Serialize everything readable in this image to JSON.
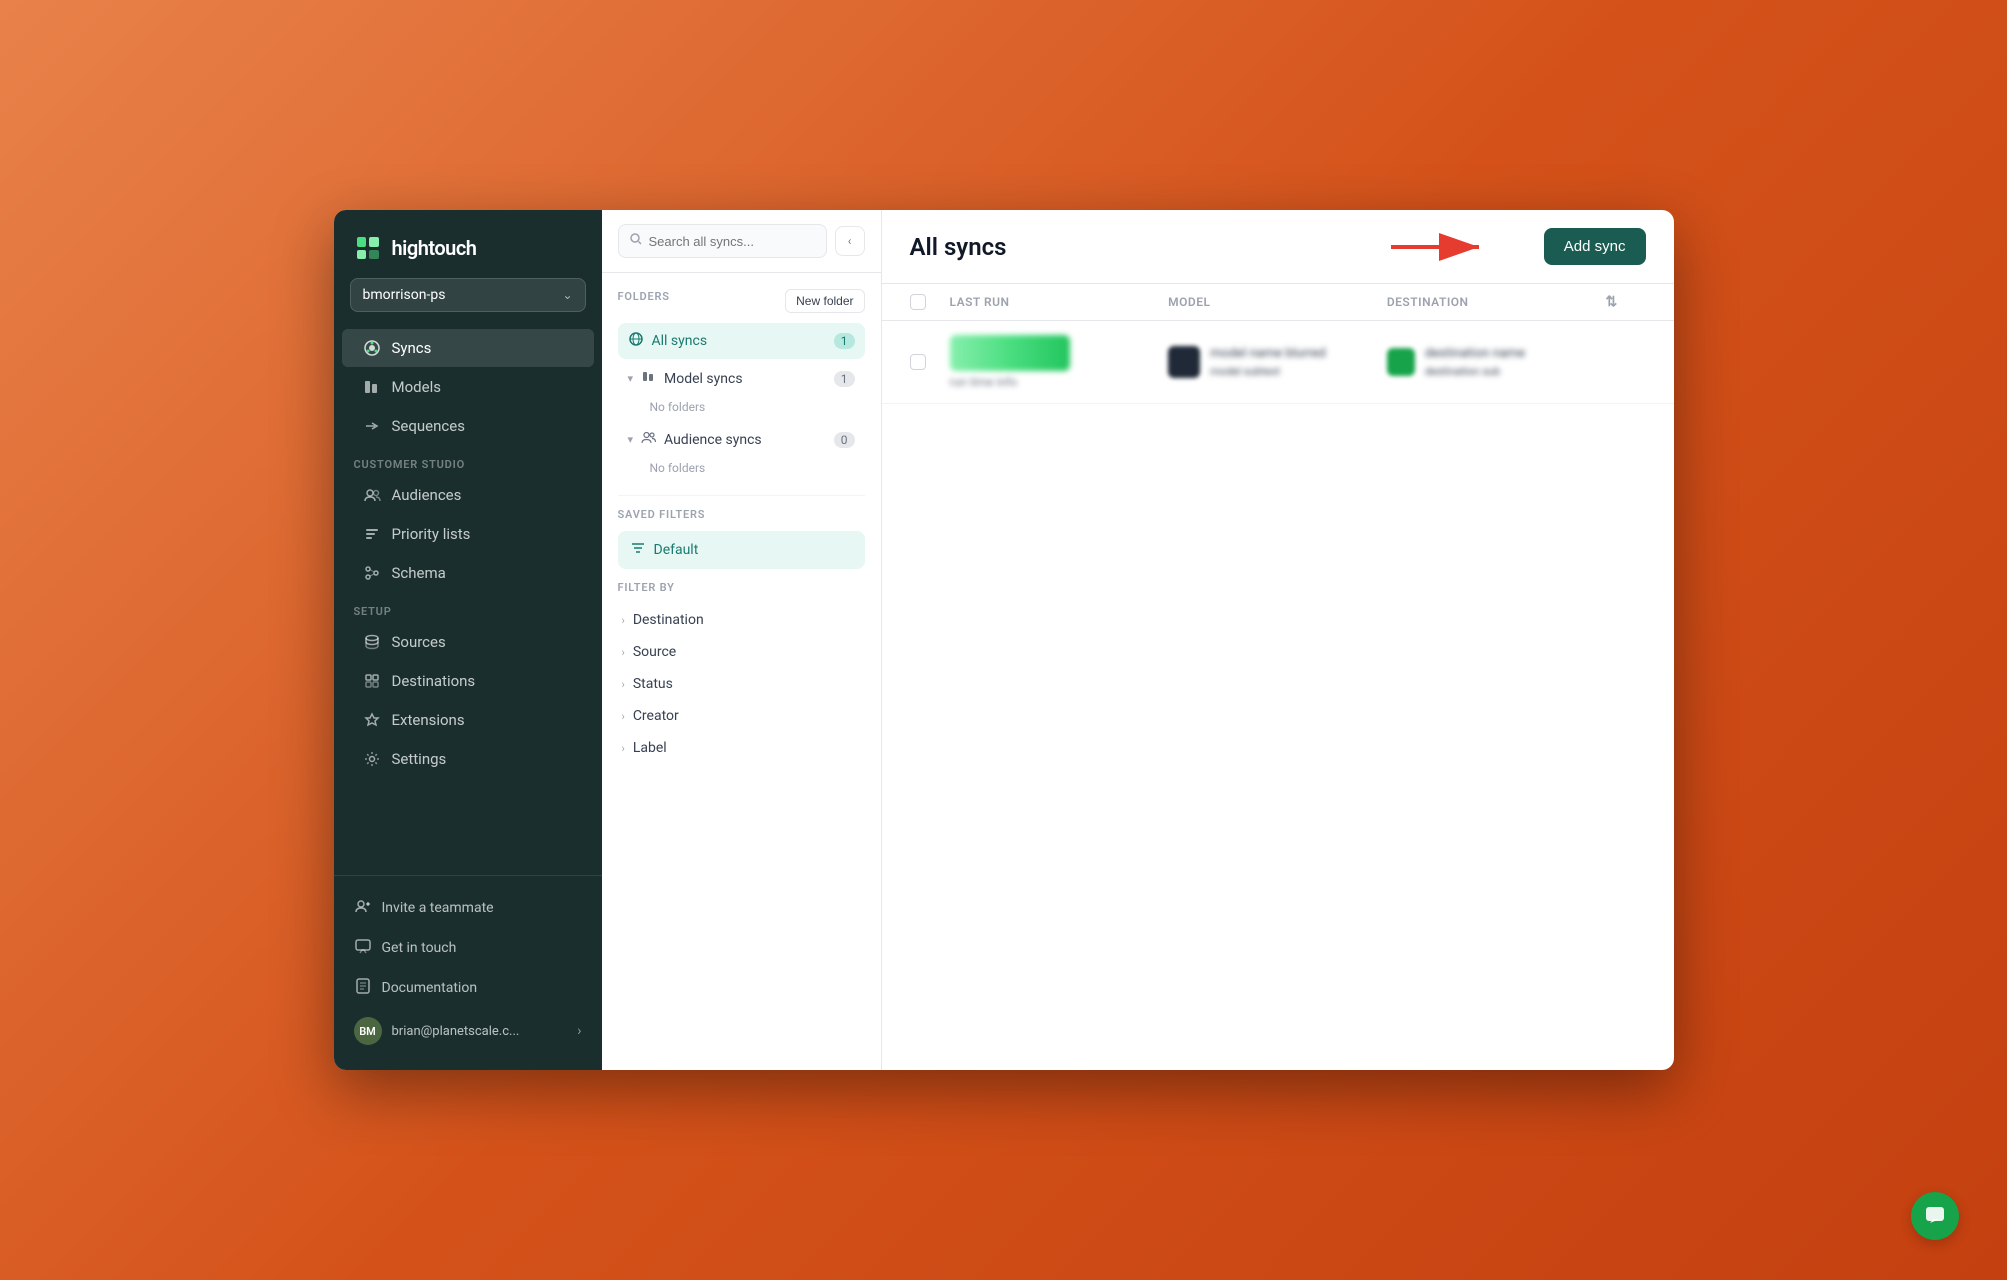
{
  "app": {
    "name": "hightouch",
    "window_title": "All syncs"
  },
  "sidebar": {
    "workspace": "bmorrison-ps",
    "nav_items": [
      {
        "id": "syncs",
        "label": "Syncs",
        "icon": "⟳",
        "active": true
      },
      {
        "id": "models",
        "label": "Models",
        "icon": "▦"
      },
      {
        "id": "sequences",
        "label": "Sequences",
        "icon": "→"
      }
    ],
    "customer_studio_label": "CUSTOMER STUDIO",
    "customer_studio_items": [
      {
        "id": "audiences",
        "label": "Audiences",
        "icon": "👥"
      },
      {
        "id": "priority-lists",
        "label": "Priority lists",
        "icon": "≡"
      },
      {
        "id": "schema",
        "label": "Schema",
        "icon": "⋮⋮"
      }
    ],
    "setup_label": "SETUP",
    "setup_items": [
      {
        "id": "sources",
        "label": "Sources",
        "icon": "≡"
      },
      {
        "id": "destinations",
        "label": "Destinations",
        "icon": "▦"
      },
      {
        "id": "extensions",
        "label": "Extensions",
        "icon": "⚙"
      },
      {
        "id": "settings",
        "label": "Settings",
        "icon": "⚙"
      }
    ],
    "bottom_items": [
      {
        "id": "invite",
        "label": "Invite a teammate",
        "icon": "👤+"
      },
      {
        "id": "get-in-touch",
        "label": "Get in touch",
        "icon": "💬"
      },
      {
        "id": "documentation",
        "label": "Documentation",
        "icon": "📖"
      }
    ],
    "user": {
      "initials": "BM",
      "email": "brian@planetscale.c..."
    }
  },
  "filter_panel": {
    "search_placeholder": "Search all syncs...",
    "folders_label": "FOLDERS",
    "new_folder_label": "New folder",
    "collapse_icon": "‹",
    "folder_items": [
      {
        "id": "all-syncs",
        "label": "All syncs",
        "count": 1,
        "active": true,
        "icon": "🌐"
      },
      {
        "id": "model-syncs",
        "label": "Model syncs",
        "count": 1,
        "active": false,
        "expanded": true,
        "icon": "▦"
      },
      {
        "id": "audience-syncs",
        "label": "Audience syncs",
        "count": 0,
        "active": false,
        "expanded": true,
        "icon": "👥"
      }
    ],
    "no_folders_label": "No folders",
    "saved_filters_label": "SAVED FILTERS",
    "default_filter_label": "Default",
    "filter_by_label": "FILTER BY",
    "filter_by_items": [
      {
        "id": "destination",
        "label": "Destination"
      },
      {
        "id": "source",
        "label": "Source"
      },
      {
        "id": "status",
        "label": "Status"
      },
      {
        "id": "creator",
        "label": "Creator"
      },
      {
        "id": "label",
        "label": "Label"
      }
    ]
  },
  "content": {
    "page_title": "All syncs",
    "add_sync_label": "Add sync",
    "table_headers": [
      {
        "id": "last-run",
        "label": "LAST RUN"
      },
      {
        "id": "model",
        "label": "MODEL"
      },
      {
        "id": "destination",
        "label": "DESTINATION"
      }
    ],
    "rows": [
      {
        "id": "row-1",
        "last_run_blurred": true,
        "model_blurred": true,
        "destination_blurred": true
      }
    ]
  },
  "chat_bubble": {
    "icon": "💬"
  }
}
